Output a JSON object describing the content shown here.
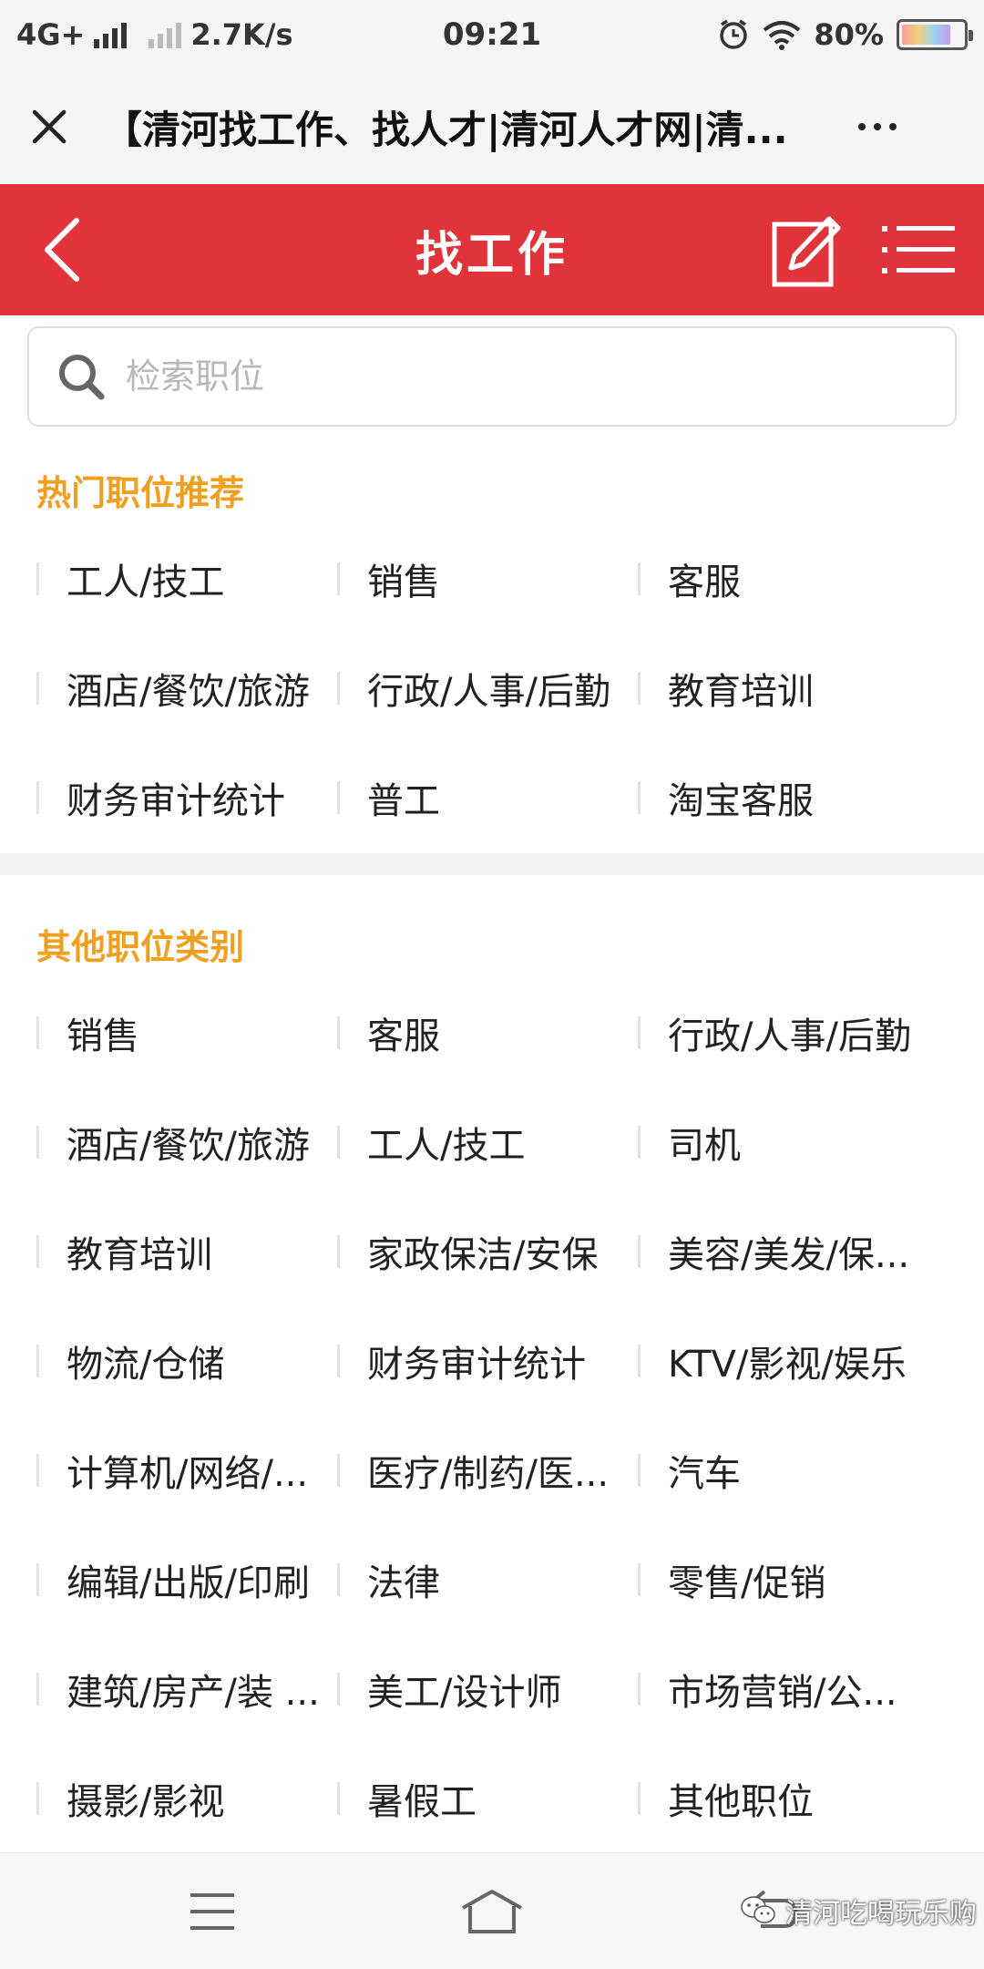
{
  "status_bar": {
    "network": "4G+",
    "speed": "2.7K/s",
    "time": "09:21",
    "battery": "80%",
    "battery_level": 0.8
  },
  "title_bar": {
    "title": "【清河找工作、找人才|清河人才网|清..."
  },
  "header": {
    "title": "找工作"
  },
  "search": {
    "placeholder": "检索职位"
  },
  "hot_section": {
    "title": "热门职位推荐",
    "items": [
      "工人/技工",
      "销售",
      "客服",
      "酒店/餐饮/旅游",
      "行政/人事/后勤",
      "教育培训",
      "财务审计统计",
      "普工",
      "淘宝客服"
    ]
  },
  "other_section": {
    "title": "其他职位类别",
    "items": [
      "销售",
      "客服",
      "行政/人事/后勤",
      "酒店/餐饮/旅游",
      "工人/技工",
      "司机",
      "教育培训",
      "家政保洁/安保",
      "美容/美发/保...",
      "物流/仓储",
      "财务审计统计",
      "KTV/影视/娱乐",
      "计算机/网络/...",
      "医疗/制药/医...",
      "汽车",
      "编辑/出版/印刷",
      "法律",
      "零售/促销",
      "建筑/房产/装 ...",
      "美工/设计师",
      "市场营销/公...",
      "摄影/影视",
      "暑假工",
      "其他职位"
    ]
  },
  "watermark": {
    "text": "清河吃喝玩乐购"
  },
  "colors": {
    "header_red": "#e0343a",
    "section_orange": "#f0a020"
  }
}
